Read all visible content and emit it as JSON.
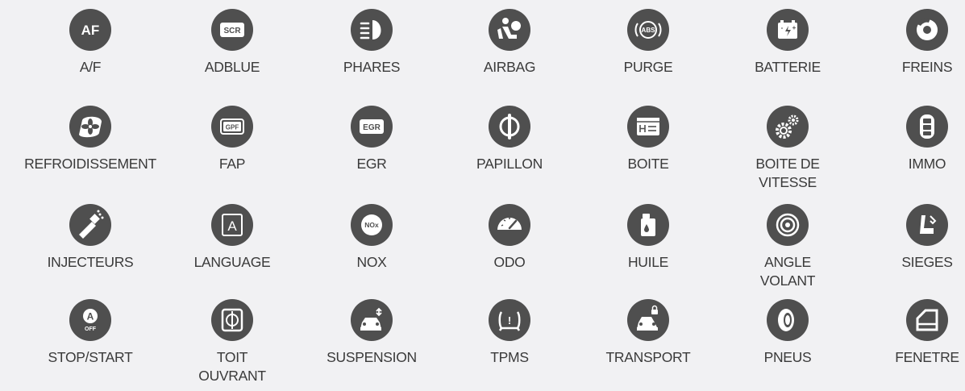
{
  "colors": {
    "background": "#f1f1f3",
    "icon_bg": "#4f4f4f",
    "icon_fg": "#ffffff",
    "label": "#3a3a3a"
  },
  "functions": [
    {
      "label": "A/F",
      "icon": "af-icon"
    },
    {
      "label": "ADBLUE",
      "icon": "scr-icon"
    },
    {
      "label": "PHARES",
      "icon": "headlight-icon"
    },
    {
      "label": "AIRBAG",
      "icon": "airbag-icon"
    },
    {
      "label": "PURGE",
      "icon": "abs-icon"
    },
    {
      "label": "BATTERIE",
      "icon": "battery-icon"
    },
    {
      "label": "FREINS",
      "icon": "brake-disc-icon"
    },
    {
      "label": "REFROIDISSEMENT",
      "icon": "cooling-fan-icon"
    },
    {
      "label": "FAP",
      "icon": "gpf-icon"
    },
    {
      "label": "EGR",
      "icon": "egr-icon"
    },
    {
      "label": "PAPILLON",
      "icon": "throttle-icon"
    },
    {
      "label": "BOITE",
      "icon": "gearbox-screen-icon"
    },
    {
      "label": "BOITE DE\nVITESSE",
      "icon": "gears-icon"
    },
    {
      "label": "IMMO",
      "icon": "car-key-icon"
    },
    {
      "label": "INJECTEURS",
      "icon": "injector-icon"
    },
    {
      "label": "LANGUAGE",
      "icon": "language-icon"
    },
    {
      "label": "NOX",
      "icon": "nox-icon"
    },
    {
      "label": "ODO",
      "icon": "odometer-icon"
    },
    {
      "label": "HUILE",
      "icon": "oil-can-icon"
    },
    {
      "label": "ANGLE\nVOLANT",
      "icon": "steering-angle-icon"
    },
    {
      "label": "SIEGES",
      "icon": "seat-icon"
    },
    {
      "label": "STOP/START",
      "icon": "stop-start-icon"
    },
    {
      "label": "TOIT\nOUVRANT",
      "icon": "sunroof-icon"
    },
    {
      "label": "SUSPENSION",
      "icon": "suspension-icon"
    },
    {
      "label": "TPMS",
      "icon": "tpms-icon"
    },
    {
      "label": "TRANSPORT",
      "icon": "transport-mode-icon"
    },
    {
      "label": "PNEUS",
      "icon": "tire-icon"
    },
    {
      "label": "FENETRE",
      "icon": "window-icon"
    }
  ]
}
